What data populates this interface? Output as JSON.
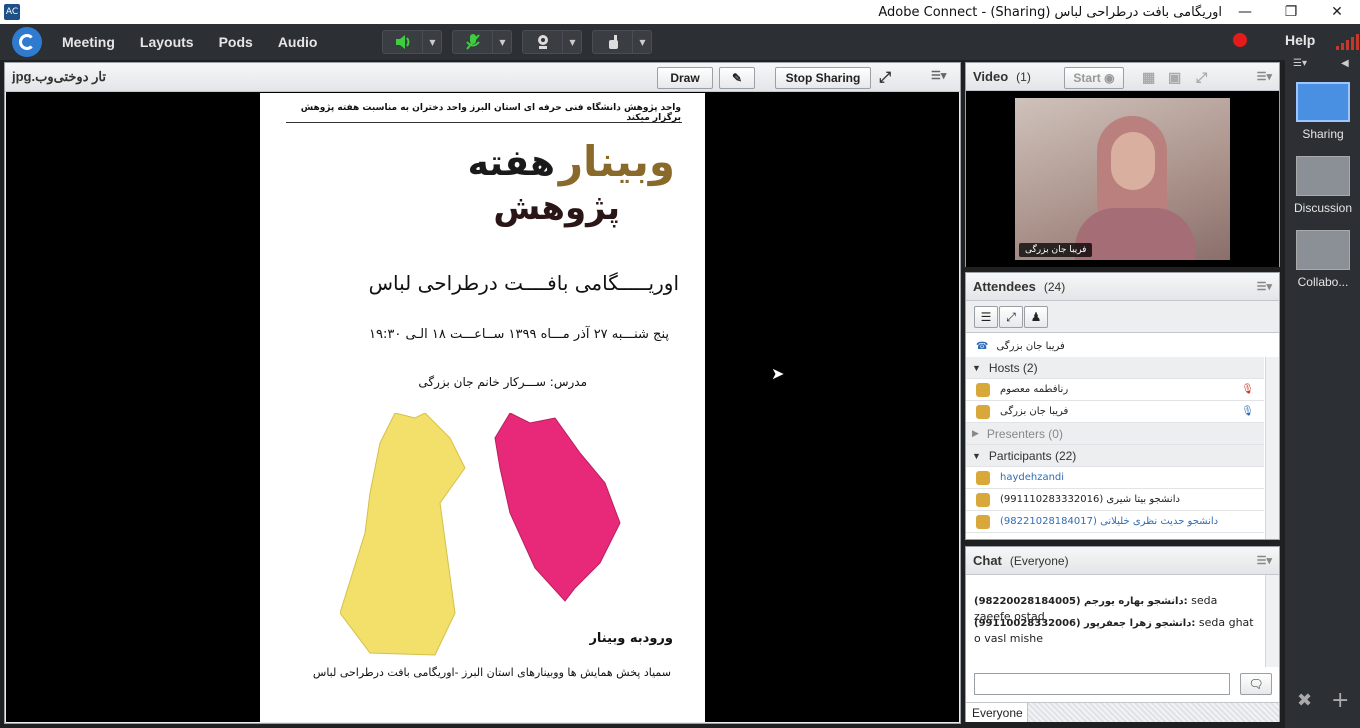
{
  "window": {
    "title": "اوریگامی بافت درطراحی لباس (Sharing) - Adobe Connect",
    "icon": "adobe-connect-icon",
    "controls": [
      "minimize-icon",
      "maximize-icon",
      "close-icon"
    ]
  },
  "menubar": {
    "items": [
      "Meeting",
      "Layouts",
      "Pods",
      "Audio"
    ],
    "help": "Help",
    "recording_color": "#e21b1b"
  },
  "share_pod": {
    "filename": "تار دوختی‌وب.jpg",
    "draw_label": "Draw",
    "stop_label": "Stop Sharing"
  },
  "poster": {
    "header": "واحد پژوهش دانشگاه فنی حرفه ای استان البرز واحد دختران به مناسبت هفته پژوهش برگزار میکند",
    "banner_word1": "وبینار",
    "banner_word2": "هفته",
    "banner_word3": "پژوهش",
    "title": "اوریـــــگامی بافــــت درطراحی لباس",
    "date": "پنج شنـــبه ۲۷ آذر مـــاه ۱۳۹۹ ســاعـــت ۱۸ الـی ۱۹:۳۰",
    "teacher": "مدرس: ســـرکار خانم جان بزرگی",
    "enter": "ورودبه وبینار",
    "footer": "سمیاد پخش همایش ها ووبینارهای استان البرز -اوریگامی بافت درطراحی لباس"
  },
  "video_pod": {
    "title": "Video",
    "count": "(1)",
    "start_label": "Start",
    "participant": "فریبا جان بزرگی"
  },
  "attendees_pod": {
    "title": "Attendees",
    "count": "(24)",
    "presenter_row": "فریبا جان بزرگی",
    "hosts": {
      "label": "Hosts (2)",
      "items": [
        "رنافطمه معصوم",
        "فریبا جان بزرگی"
      ]
    },
    "presenters": {
      "label": "Presenters (0)"
    },
    "participants": {
      "label": "Participants (22)",
      "items": [
        "haydehzandi",
        "دانشجو بیتا شیری (991110283332016)",
        "دانشجو حدیث نظری خلیلانی (98221028184017)"
      ]
    }
  },
  "chat_pod": {
    "title": "Chat",
    "scope": "(Everyone)",
    "messages": [
      {
        "sender": "دانشجو بهاره یورجم (98220028184005):",
        "text": "seda zaeefe ostad"
      },
      {
        "sender": "دانشجو زهرا جعفرپور (99110028332006):",
        "text": "seda ghat o vasl mishe"
      }
    ],
    "input_placeholder": "",
    "recipient": "Everyone"
  },
  "layouts": {
    "items": [
      "Sharing",
      "Discussion",
      "Collabo..."
    ]
  }
}
